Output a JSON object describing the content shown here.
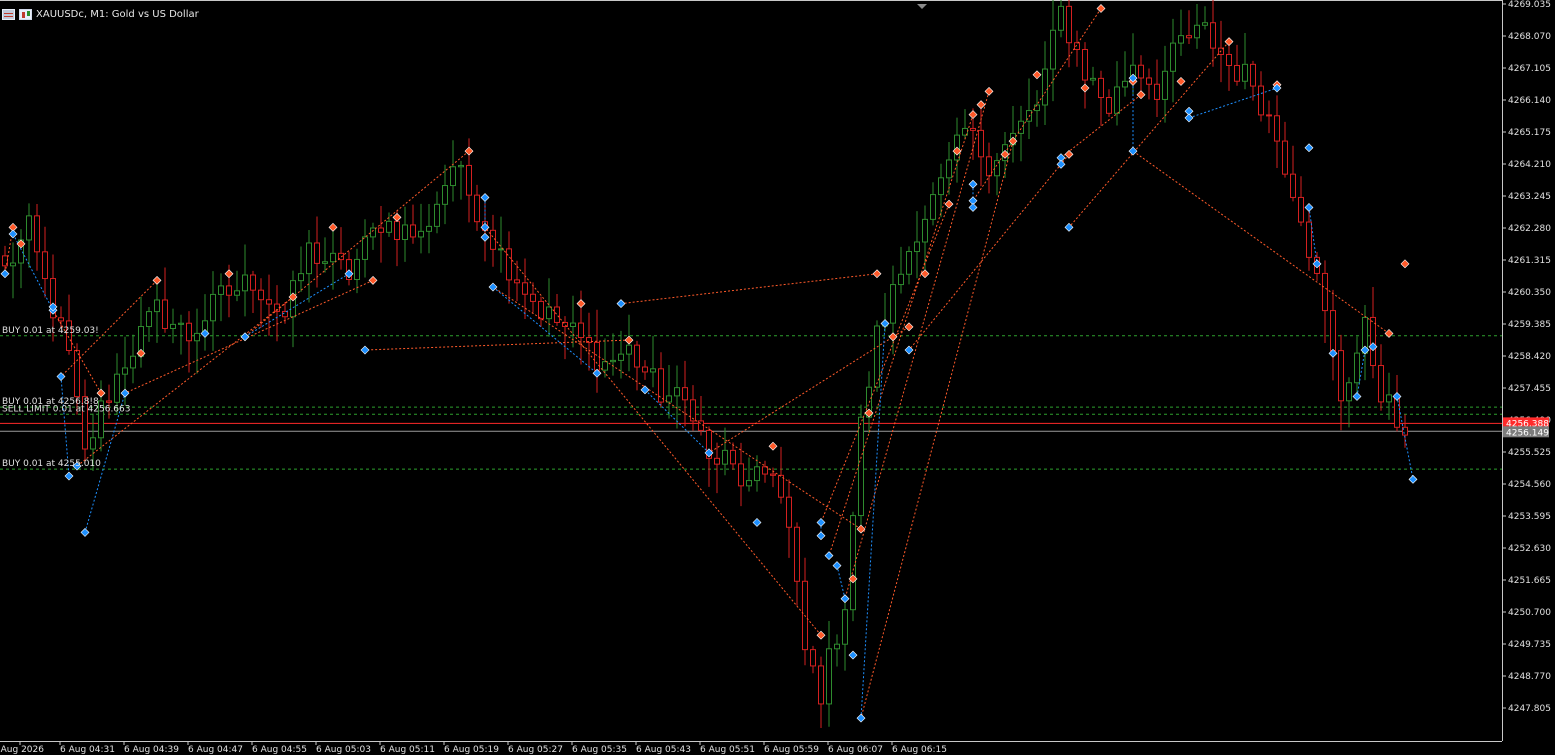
{
  "window": {
    "title": "XAUUSDc, M1:  Gold vs US Dollar"
  },
  "colors": {
    "background": "#000000",
    "bull": "#2e8b2e",
    "bear": "#d42020",
    "grid_line": "#2ea02e",
    "bid_line": "#ff2a2a",
    "ask_line": "#9a9a9a",
    "buy_marker": "#1e90ff",
    "sell_marker": "#ff5a2a",
    "axis_text": "#e0e0e0"
  },
  "chart_data": {
    "type": "candlestick",
    "symbol": "XAUUSDc",
    "timeframe": "M1",
    "ylim": [
      4247.0,
      4269.3
    ],
    "price_ticks": [
      "4269.035",
      "4268.070",
      "4267.105",
      "4266.140",
      "4265.175",
      "4264.210",
      "4263.245",
      "4262.280",
      "4261.315",
      "4260.350",
      "4259.385",
      "4258.420",
      "4257.455",
      "4256.490",
      "4255.525",
      "4254.560",
      "4253.595",
      "4252.630",
      "4251.665",
      "4250.700",
      "4249.735",
      "4248.770",
      "4247.805"
    ],
    "time_ticks": [
      "6 Aug 2026",
      "6 Aug 04:31",
      "6 Aug 04:39",
      "6 Aug 04:47",
      "6 Aug 04:55",
      "6 Aug 05:03",
      "6 Aug 05:11",
      "6 Aug 05:19",
      "6 Aug 05:27",
      "6 Aug 05:35",
      "6 Aug 05:43",
      "6 Aug 05:51",
      "6 Aug 05:59",
      "6 Aug 06:07",
      "6 Aug 06:15"
    ],
    "bid_price": "4256.388",
    "ask_price": "4256.149",
    "order_levels": [
      {
        "label": "BUY 0.01 at 4259.03!",
        "price": 4259.03
      },
      {
        "label": "BUY 0.01 at 4256.8!8",
        "price": 4256.88
      },
      {
        "label": "SELL LIMIT 0.01 at 4256.663",
        "price": 4256.663
      },
      {
        "label": "BUY 0.01 at 4255.010",
        "price": 4255.01
      }
    ],
    "waypoints": [
      [
        0,
        4261.0
      ],
      [
        3,
        4262.2
      ],
      [
        5,
        4260.6
      ],
      [
        8,
        4258.4
      ],
      [
        10,
        4255.4
      ],
      [
        12,
        4256.8
      ],
      [
        15,
        4258.3
      ],
      [
        19,
        4259.8
      ],
      [
        23,
        4259.0
      ],
      [
        27,
        4260.2
      ],
      [
        31,
        4260.7
      ],
      [
        35,
        4259.6
      ],
      [
        38,
        4261.6
      ],
      [
        43,
        4260.9
      ],
      [
        47,
        4262.5
      ],
      [
        52,
        4262.0
      ],
      [
        56,
        4264.2
      ],
      [
        59,
        4262.9
      ],
      [
        62,
        4261.5
      ],
      [
        67,
        4259.8
      ],
      [
        71,
        4259.1
      ],
      [
        75,
        4258.2
      ],
      [
        78,
        4258.6
      ],
      [
        82,
        4257.3
      ],
      [
        86,
        4256.9
      ],
      [
        88,
        4255.2
      ],
      [
        90,
        4255.3
      ],
      [
        93,
        4254.4
      ],
      [
        96,
        4255.1
      ],
      [
        98,
        4253.1
      ],
      [
        100,
        4249.5
      ],
      [
        102,
        4248.3
      ],
      [
        105,
        4251.0
      ],
      [
        107,
        4256.3
      ],
      [
        109,
        4259.0
      ],
      [
        111,
        4260.3
      ],
      [
        114,
        4262.3
      ],
      [
        117,
        4263.5
      ],
      [
        120,
        4265.2
      ],
      [
        123,
        4264.3
      ],
      [
        126,
        4265.0
      ],
      [
        129,
        4266.0
      ],
      [
        132,
        4268.8
      ],
      [
        135,
        4267.0
      ],
      [
        138,
        4265.9
      ],
      [
        141,
        4267.3
      ],
      [
        144,
        4266.5
      ],
      [
        147,
        4267.9
      ],
      [
        150,
        4268.2
      ],
      [
        153,
        4267.2
      ],
      [
        156,
        4266.7
      ],
      [
        159,
        4265.0
      ],
      [
        162,
        4262.8
      ],
      [
        165,
        4259.6
      ],
      [
        167,
        4257.2
      ],
      [
        170,
        4259.2
      ],
      [
        172,
        4257.4
      ],
      [
        174,
        4256.4
      ],
      [
        175,
        4255.6
      ]
    ],
    "sell_markers": [
      [
        1,
        4262.3
      ],
      [
        2,
        4261.8
      ],
      [
        12,
        4257.3
      ],
      [
        17,
        4258.5
      ],
      [
        19,
        4260.7
      ],
      [
        28,
        4260.9
      ],
      [
        36,
        4260.2
      ],
      [
        41,
        4262.3
      ],
      [
        46,
        4260.7
      ],
      [
        49,
        4262.6
      ],
      [
        58,
        4264.6
      ],
      [
        72,
        4260.0
      ],
      [
        78,
        4258.9
      ],
      [
        96,
        4255.7
      ],
      [
        102,
        4250.0
      ],
      [
        106,
        4251.7
      ],
      [
        107,
        4253.2
      ],
      [
        108,
        4256.7
      ],
      [
        109,
        4260.9
      ],
      [
        111,
        4259.0
      ],
      [
        113,
        4259.3
      ],
      [
        115,
        4260.9
      ],
      [
        118,
        4263.0
      ],
      [
        119,
        4264.6
      ],
      [
        121,
        4265.7
      ],
      [
        122,
        4266.0
      ],
      [
        123,
        4266.4
      ],
      [
        125,
        4264.5
      ],
      [
        126,
        4264.9
      ],
      [
        129,
        4266.9
      ],
      [
        133,
        4264.5
      ],
      [
        135,
        4266.5
      ],
      [
        137,
        4268.9
      ],
      [
        141,
        4266.7
      ],
      [
        142,
        4266.3
      ],
      [
        147,
        4266.7
      ],
      [
        153,
        4267.9
      ],
      [
        159,
        4266.6
      ],
      [
        173,
        4259.1
      ],
      [
        175,
        4261.2
      ]
    ],
    "buy_markers": [
      [
        0,
        4260.9
      ],
      [
        1,
        4262.1
      ],
      [
        6,
        4259.8
      ],
      [
        6,
        4259.9
      ],
      [
        7,
        4257.8
      ],
      [
        8,
        4254.8
      ],
      [
        9,
        4255.1
      ],
      [
        10,
        4253.1
      ],
      [
        15,
        4257.3
      ],
      [
        25,
        4259.1
      ],
      [
        30,
        4259.0
      ],
      [
        43,
        4260.9
      ],
      [
        45,
        4258.6
      ],
      [
        60,
        4263.2
      ],
      [
        60,
        4262.3
      ],
      [
        60,
        4262.0
      ],
      [
        61,
        4260.5
      ],
      [
        74,
        4257.9
      ],
      [
        77,
        4260.0
      ],
      [
        80,
        4257.4
      ],
      [
        88,
        4255.5
      ],
      [
        94,
        4253.4
      ],
      [
        102,
        4253.4
      ],
      [
        102,
        4253.0
      ],
      [
        103,
        4252.4
      ],
      [
        104,
        4252.1
      ],
      [
        105,
        4251.1
      ],
      [
        106,
        4249.4
      ],
      [
        107,
        4247.5
      ],
      [
        110,
        4259.4
      ],
      [
        113,
        4258.6
      ],
      [
        121,
        4263.6
      ],
      [
        121,
        4263.1
      ],
      [
        121,
        4262.9
      ],
      [
        132,
        4264.4
      ],
      [
        132,
        4264.2
      ],
      [
        133,
        4262.3
      ],
      [
        141,
        4266.8
      ],
      [
        141,
        4264.6
      ],
      [
        148,
        4265.8
      ],
      [
        148,
        4265.6
      ],
      [
        159,
        4266.5
      ],
      [
        163,
        4264.7
      ],
      [
        163,
        4262.9
      ],
      [
        164,
        4261.2
      ],
      [
        166,
        4258.5
      ],
      [
        169,
        4257.2
      ],
      [
        170,
        4258.6
      ],
      [
        171,
        4258.7
      ],
      [
        174,
        4257.2
      ],
      [
        176,
        4254.7
      ]
    ]
  }
}
